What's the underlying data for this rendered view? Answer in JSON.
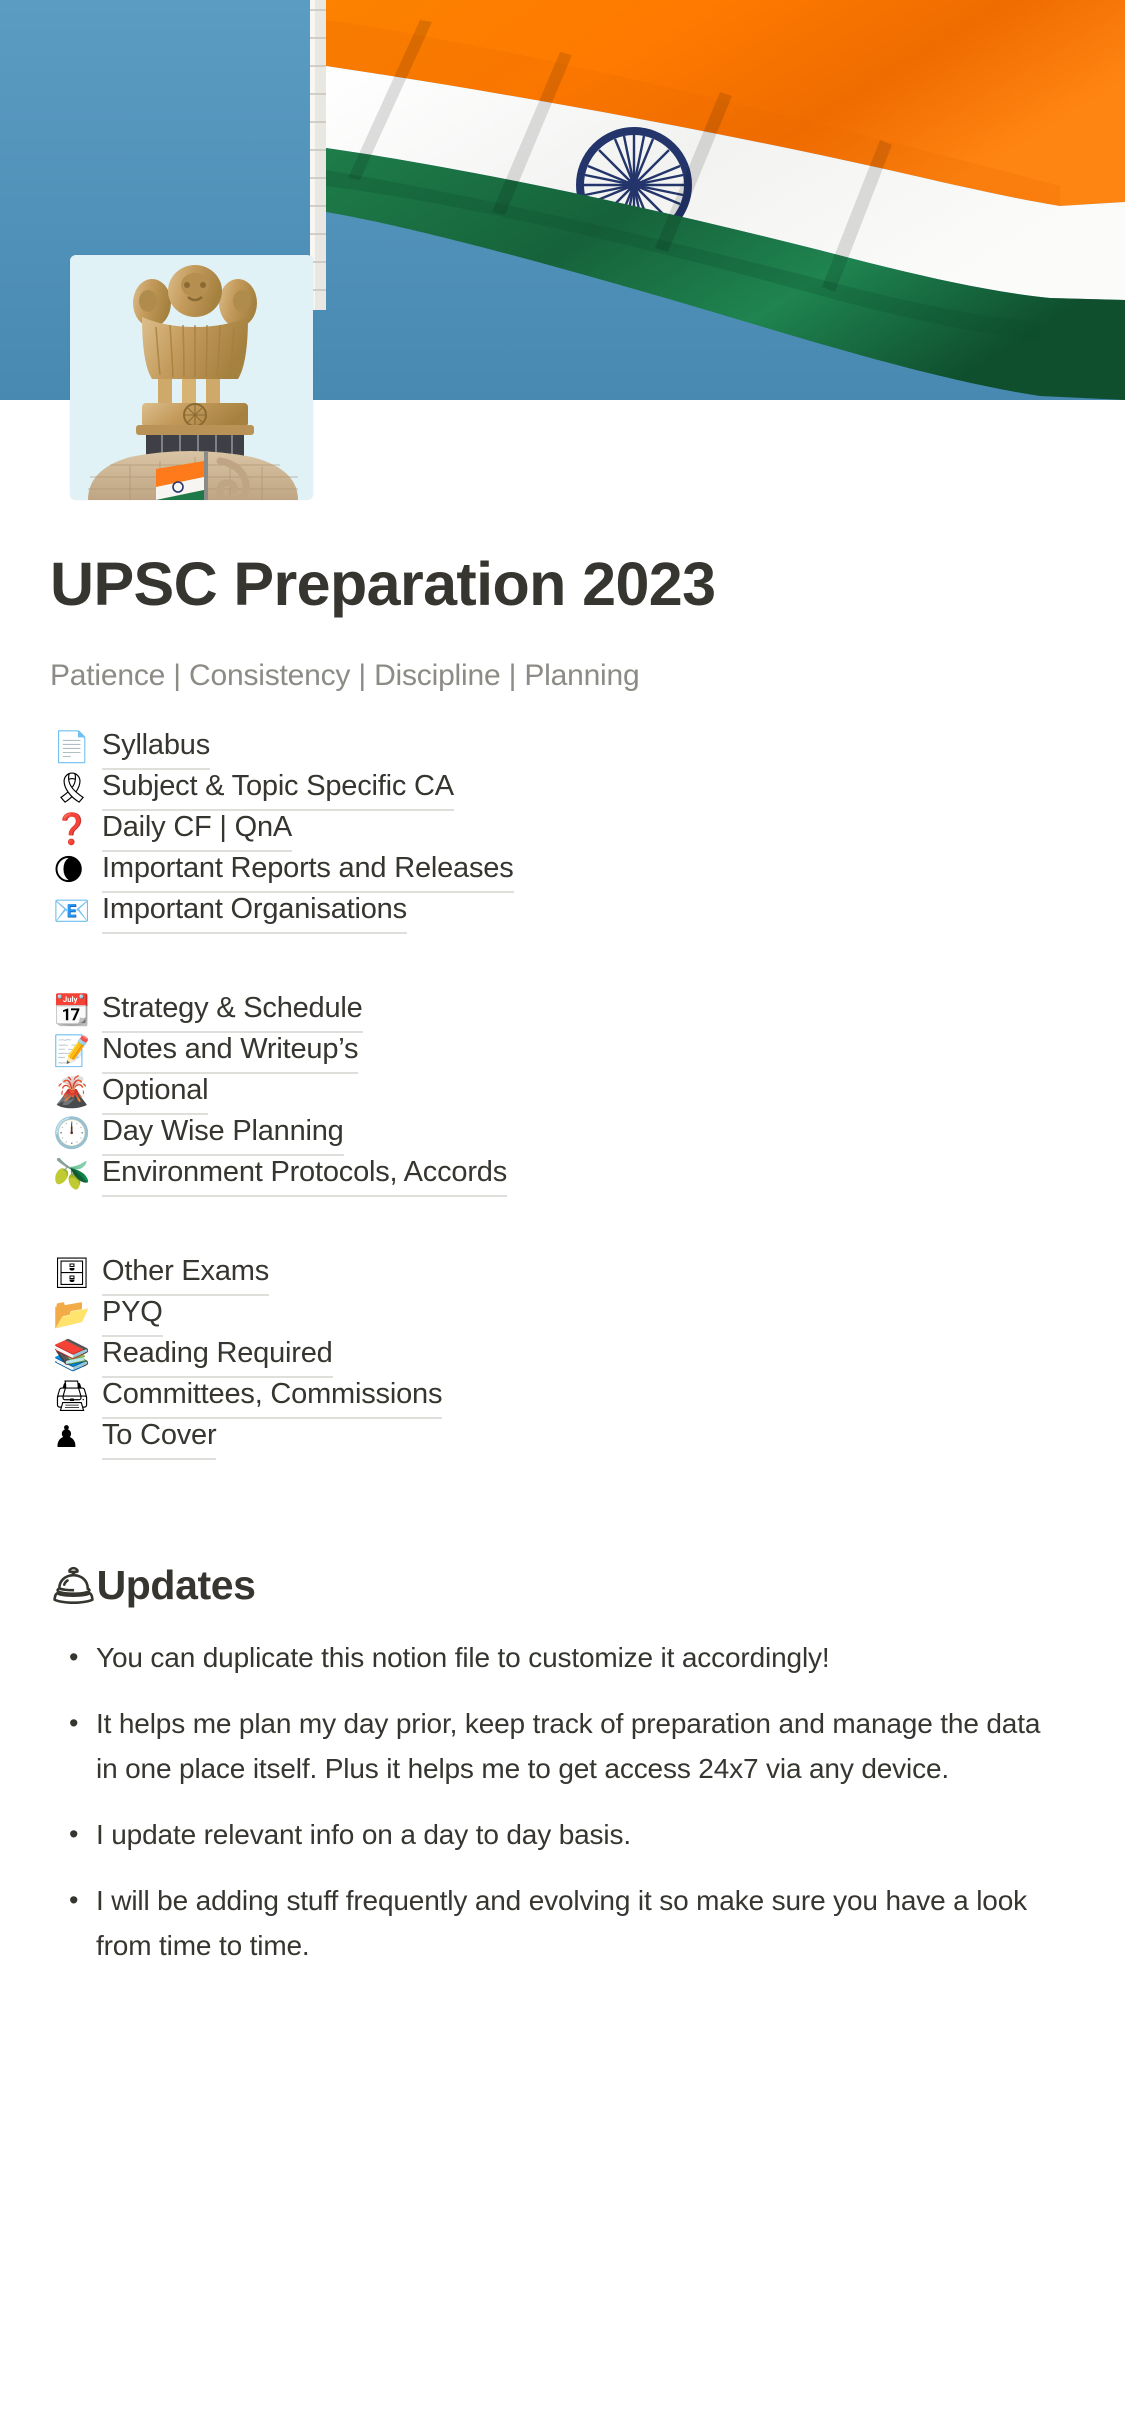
{
  "cover": {
    "alt": "Indian national flag waving against blue sky",
    "sky_color": "#4e93bb",
    "saffron_color": "#ff7a00",
    "white_color": "#f7f7f5",
    "green_color": "#1d7a48",
    "chakra_color": "#23356b",
    "pole_color": "#e8e6e0"
  },
  "page_icon": {
    "alt": "Ashoka Lion Capital atop building with Indian flag",
    "sky_color": "#dff1f5",
    "gold_color": "#c9a063",
    "stone_color": "#cbb392"
  },
  "header": {
    "title": "UPSC Preparation 2023",
    "subtitle": "Patience | Consistency | Discipline | Planning"
  },
  "link_groups": [
    {
      "items": [
        {
          "icon": "📄",
          "icon_name": "page-facing-up-icon",
          "label": "Syllabus"
        },
        {
          "icon": "🎗",
          "icon_name": "reminder-ribbon-icon",
          "label": "Subject & Topic Specific CA"
        },
        {
          "icon": "❓",
          "icon_name": "red-question-mark-icon",
          "label": "Daily CF | QnA"
        },
        {
          "icon": "🌘",
          "icon_name": "waning-crescent-moon-icon",
          "label": "Important Reports and Releases"
        },
        {
          "icon": "📧",
          "icon_name": "e-mail-icon",
          "label": "Important Organisations"
        }
      ]
    },
    {
      "items": [
        {
          "icon": "📆",
          "icon_name": "tear-off-calendar-icon",
          "label": "Strategy & Schedule"
        },
        {
          "icon": "📝",
          "icon_name": "memo-icon",
          "label": "Notes and Writeup’s"
        },
        {
          "icon": "🌋",
          "icon_name": "volcano-icon",
          "label": "Optional"
        },
        {
          "icon": "🕛",
          "icon_name": "clock-face-icon",
          "label": "Day Wise Planning"
        },
        {
          "icon": "🫒",
          "icon_name": "olive-icon",
          "label": "Environment Protocols, Accords"
        }
      ]
    },
    {
      "items": [
        {
          "icon": "🗄",
          "icon_name": "file-cabinet-icon",
          "label": "Other Exams"
        },
        {
          "icon": "📂",
          "icon_name": "open-file-folder-icon",
          "label": "PYQ"
        },
        {
          "icon": "📚",
          "icon_name": "books-icon",
          "label": "Reading Required"
        },
        {
          "icon": "🖨",
          "icon_name": "printer-icon",
          "label": "Committees, Commissions"
        },
        {
          "icon": "♟",
          "icon_name": "chess-pawn-icon",
          "label": "To Cover"
        }
      ]
    }
  ],
  "updates": {
    "icon": "🛎",
    "icon_name": "bellhop-bell-icon",
    "heading": "Updates",
    "bullets": [
      "You can duplicate this notion file to customize it accordingly!",
      "It helps me plan my day prior, keep track of preparation and manage the data in one place itself. Plus it helps me to get access 24x7 via any device.",
      "I update relevant info on a day to day basis.",
      "I will be adding stuff frequently and evolving it so make sure you have a look from time to time."
    ]
  }
}
